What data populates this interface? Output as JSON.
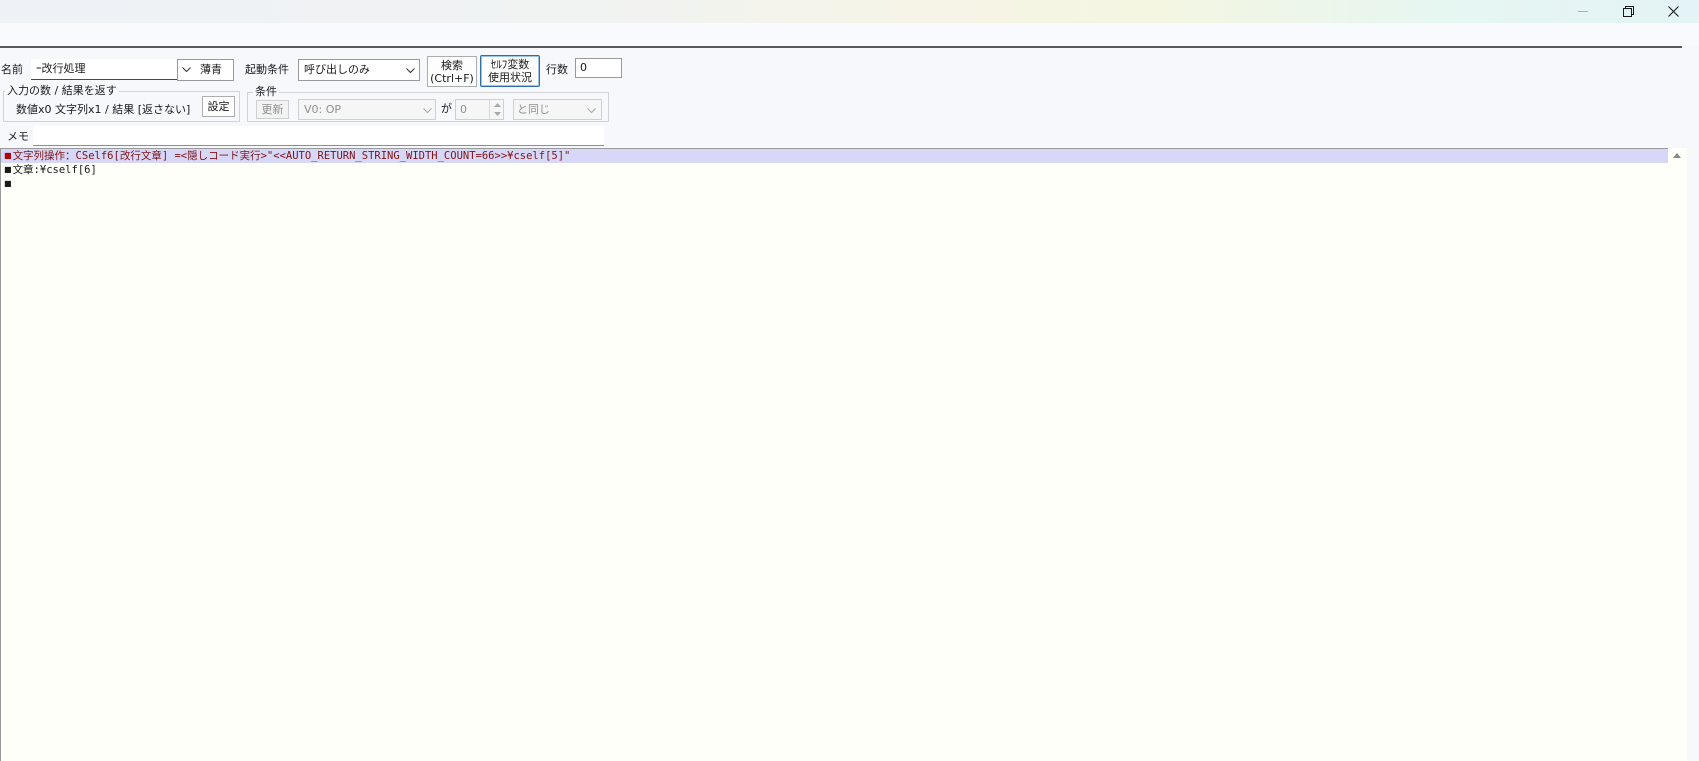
{
  "window": {
    "minimize_glyph": "—",
    "restore_glyph": "❐",
    "close_glyph": "✕"
  },
  "form": {
    "name_label": "名前",
    "name_value": "ｰ改行処理",
    "color_value": "薄青",
    "trigger_label": "起動条件",
    "trigger_value": "呼び出しのみ",
    "search_button_line1": "検索",
    "search_button_line2": "(Ctrl+F)",
    "self_var_button_line1": "ｾﾙﾌ変数",
    "self_var_button_line2": "使用状況",
    "line_count_label": "行数",
    "line_count_value": "0"
  },
  "io_group": {
    "legend": "入力の数 / 結果を返す",
    "summary": "数値x0 文字列x1 / 結果 [返さない]",
    "settings_button": "設定"
  },
  "condition_group": {
    "legend": "条件",
    "update_button": "更新",
    "variable_value": "V0: OP",
    "ga_label": "が",
    "number_value": "0",
    "operator_value": "と同じ"
  },
  "memo": {
    "label": "メモ",
    "value": ""
  },
  "editor": {
    "lines": [
      {
        "text": "文字列操作：CSelf6[改行文章] =<隠しコード実行>\"<<AUTO_RETURN_STRING_WIDTH_COUNT=66>>¥cself[5]\"",
        "color": "#7f1414",
        "bullet_color": "#b00000",
        "selected": true
      },
      {
        "text": "文章:¥cself[6]",
        "color": "#1a1a1a",
        "bullet_color": "#1a1a1a",
        "selected": false
      },
      {
        "text": "",
        "color": "#1a1a1a",
        "bullet_color": "#1a1a1a",
        "selected": false
      }
    ],
    "bullet": "■",
    "selection_color": "#d7d7f8",
    "background": "#fefff8"
  },
  "colors": {
    "accent_border": "#2f6fa8",
    "rule": "#5a5a5a"
  }
}
